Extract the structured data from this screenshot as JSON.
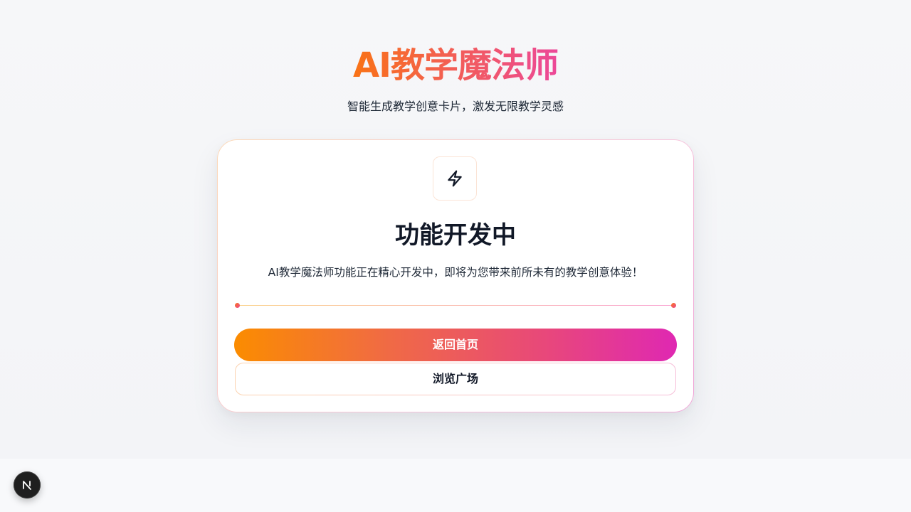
{
  "header": {
    "title": "AI教学魔法师",
    "subtitle": "智能生成教学创意卡片，激发无限教学灵感"
  },
  "card": {
    "icon": "lightning-icon",
    "title": "功能开发中",
    "description": "AI教学魔法师功能正在精心开发中，即将为您带来前所未有的教学创意体验！",
    "primary_button_label": "返回首页",
    "secondary_button_label": "浏览广场"
  },
  "dev_badge": {
    "icon": "nextjs-logo-icon",
    "letter": "N"
  },
  "colors": {
    "gradient_start": "#f97316",
    "gradient_end": "#ec4899",
    "title_text": "#111827",
    "badge_background": "#1f1f1f"
  }
}
